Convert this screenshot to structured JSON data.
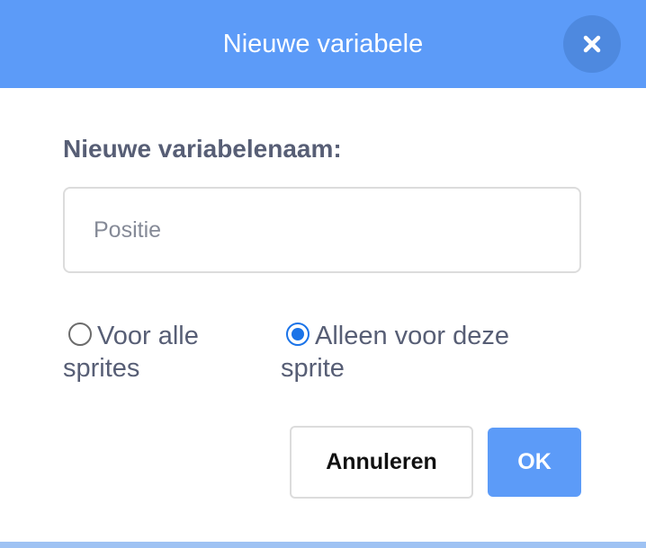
{
  "dialog": {
    "title": "Nieuwe variabele",
    "close_icon": "close-icon"
  },
  "form": {
    "label": "Nieuwe variabelenaam:",
    "name_placeholder": "Positie",
    "name_value": ""
  },
  "scope": {
    "options": [
      {
        "label": "Voor alle sprites",
        "selected": false
      },
      {
        "label": "Alleen voor deze sprite",
        "selected": true
      }
    ]
  },
  "buttons": {
    "cancel": "Annuleren",
    "ok": "OK"
  },
  "colors": {
    "accent": "#5c9bf8",
    "close_button_bg": "#4e89df",
    "text": "#575e75",
    "radio_selected": "#1a73e8"
  }
}
